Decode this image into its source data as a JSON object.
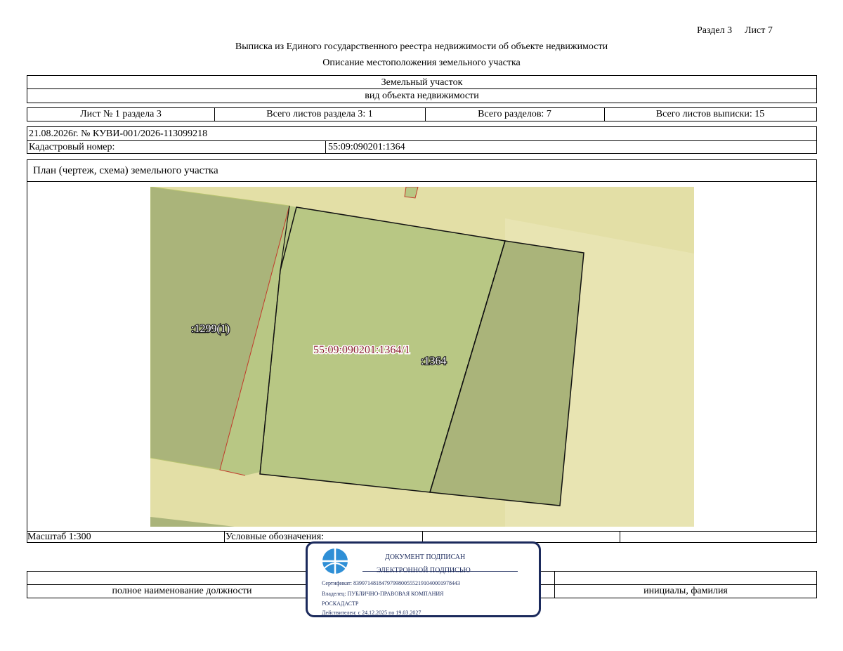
{
  "header": {
    "section": "Раздел 3",
    "sheet": "Лист 7",
    "title": "Выписка из Единого государственного реестра недвижимости об объекте недвижимости",
    "subtitle": "Описание местоположения земельного участка"
  },
  "object": {
    "type_value": "Земельный участок",
    "type_caption": "вид объекта недвижимости"
  },
  "sheets_row": {
    "sheet_no": "Лист № 1 раздела 3",
    "total_section_sheets": "Всего листов раздела 3: 1",
    "total_sections": "Всего разделов: 7",
    "total_extract_sheets": "Всего листов выписки: 15"
  },
  "document": {
    "date_number": "21.08.2026г. № КУВИ-001/2026-113099218",
    "cadastral_label": "Кадастровый номер:",
    "cadastral_value": "55:09:090201:1364"
  },
  "plan": {
    "heading": "План (чертеж, схема) земельного участка",
    "labels": {
      "neighbor": ":1299(1)",
      "part": "55:09:090201:1364/1",
      "parcel": ":1364"
    },
    "colors": {
      "background": "#e3dfa6",
      "background_light": "#e8e4b2",
      "neighbor_fill": "#aab47a",
      "parcel_fill": "#b8c784",
      "part_label": "#8b1e2e"
    }
  },
  "footer": {
    "scale": "Масштаб 1:300",
    "legend": "Условные обозначения:",
    "position_caption": "полное наименование должности",
    "name_caption": "инициалы, фамилия"
  },
  "signature": {
    "line1": "ДОКУМЕНТ ПОДПИСАН",
    "line2": "ЭЛЕКТРОННОЙ ПОДПИСЬЮ",
    "certificate": "Сертификат: 83997148184797998005552191040001978443",
    "owner": "Владелец: ПУБЛИЧНО-ПРАВОВАЯ КОМПАНИЯ",
    "owner2": "РОСКАДАСТР",
    "valid": "Действителен: с 24.12.2025 по 19.03.2027",
    "emblem_icon": "blue-circle-emblem-icon",
    "color": "#1b2a5c"
  }
}
